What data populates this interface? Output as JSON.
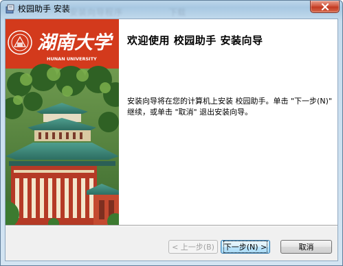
{
  "window": {
    "title": "校园助手 安装",
    "ghost_left": "安装向导程序",
    "ghost_right": "下载"
  },
  "banner": {
    "logo_chinese": "湖南大学",
    "logo_english": "HUNAN UNIVERSITY"
  },
  "content": {
    "title": "欢迎使用 校园助手 安装向导",
    "body": "安装向导将在您的计算机上安装 校园助手。单击 \"下一步(N)\" 继续，或单击 \"取消\" 退出安装向导。"
  },
  "buttons": {
    "back": "< 上一步(B)",
    "next": "下一步(N) >",
    "cancel": "取消"
  },
  "colors": {
    "banner_red": "#d33a1c",
    "title_bar": "#bcd6ea",
    "close_button": "#c23a22"
  }
}
